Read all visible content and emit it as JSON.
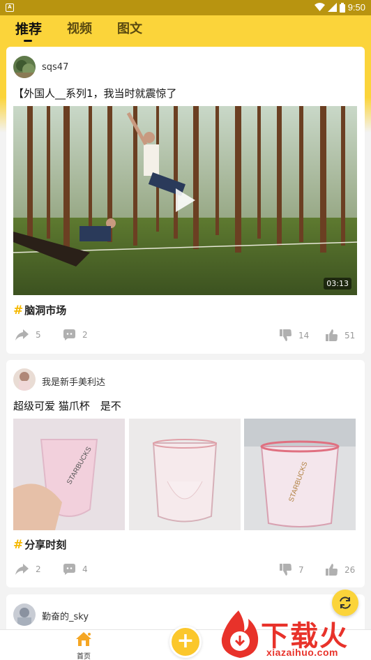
{
  "status_bar": {
    "time": "9:50"
  },
  "tabs": [
    {
      "label": "推荐",
      "active": true
    },
    {
      "label": "视频",
      "active": false
    },
    {
      "label": "图文",
      "active": false
    }
  ],
  "posts": [
    {
      "username": "sqs47",
      "text": "【外国人__系列1，我当时就震惊了",
      "video_duration": "03:13",
      "topic": "脑洞市场",
      "share_count": "5",
      "comment_count": "2",
      "dislike_count": "14",
      "like_count": "51"
    },
    {
      "username": "我是新手美利达",
      "text": "超级可爱 猫爪杯　是不",
      "topic": "分享时刻",
      "share_count": "2",
      "comment_count": "4",
      "dislike_count": "7",
      "like_count": "26"
    },
    {
      "username": "勤奋的_sky"
    }
  ],
  "bottom_nav": {
    "home_label": "首页",
    "add_label": "+"
  },
  "watermark": {
    "text": "下载火",
    "domain": "xiazaihuo.com"
  },
  "colors": {
    "accent": "#fbd43a",
    "hashtag": "#f5b800",
    "watermark": "#e8322a"
  },
  "icons": [
    "share-icon",
    "comment-icon",
    "dislike-icon",
    "like-icon",
    "home-icon",
    "refresh-icon",
    "play-icon"
  ]
}
